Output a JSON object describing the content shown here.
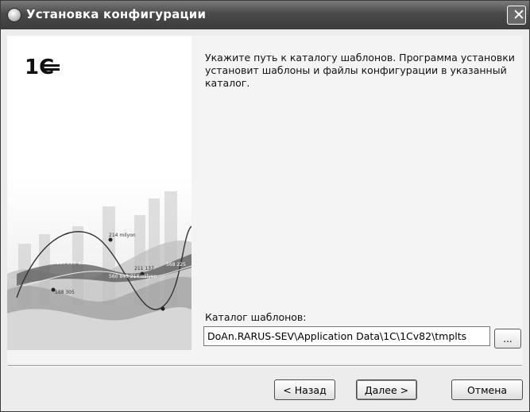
{
  "window": {
    "title": "Установка конфигурации",
    "close_glyph": "✕",
    "app_icon": "1c-installer-icon"
  },
  "side_panel": {
    "logo_text": "1С",
    "chart_labels": [
      "214 milyon",
      "560 210 ±20",
      "211 137",
      "568 225",
      "588 305",
      "560 848 214 milyon"
    ]
  },
  "content": {
    "instruction": "Укажите путь к каталогу шаблонов. Программа установки установит шаблоны и файлы конфигурации в указанный каталог.",
    "path_label": "Каталог шаблонов:",
    "path_value": "DoAn.RARUS-SEV\\Application Data\\1C\\1Cv82\\tmplts",
    "browse_label": "..."
  },
  "buttons": {
    "back": "< Назад",
    "next": "Далее >",
    "cancel": "Отмена"
  }
}
